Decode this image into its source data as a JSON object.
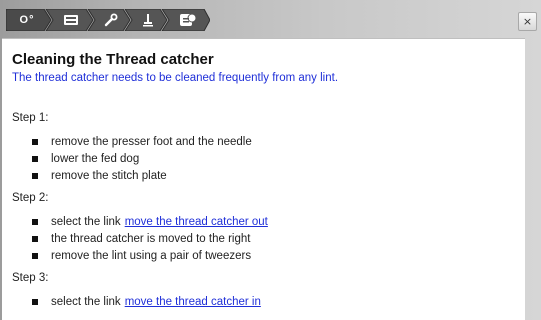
{
  "toolbar": {
    "crumbs": [
      {
        "icon": "needle-thread-icon",
        "label": "O°"
      },
      {
        "icon": "machine-icon",
        "label": ""
      },
      {
        "icon": "tools-icon",
        "label": ""
      },
      {
        "icon": "presser-foot-icon",
        "label": ""
      },
      {
        "icon": "help-icon",
        "label": ""
      }
    ],
    "active_color": "#555555",
    "close_label": "×"
  },
  "article": {
    "title": "Cleaning the Thread catcher",
    "subtitle": "The thread catcher needs to be cleaned frequently from any lint.",
    "steps": [
      {
        "label": "Step 1:",
        "items": [
          {
            "text": "remove the presser foot and the needle"
          },
          {
            "text": "lower the fed dog"
          },
          {
            "text": "remove the stitch plate"
          }
        ]
      },
      {
        "label": "Step 2:",
        "items": [
          {
            "text": "select the link",
            "link": "move the thread catcher out"
          },
          {
            "text": "the thread catcher is moved to the right"
          },
          {
            "text": "remove the lint using a pair of tweezers"
          }
        ]
      },
      {
        "label": "Step 3:",
        "items": [
          {
            "text": "select the link",
            "link": "move the thread catcher in"
          }
        ]
      }
    ],
    "link_color": "#1f2fd8"
  }
}
